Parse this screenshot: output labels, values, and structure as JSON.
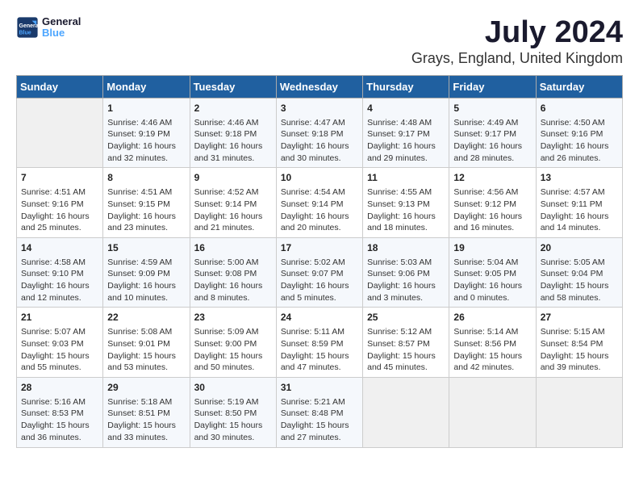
{
  "header": {
    "logo_line1": "General",
    "logo_line2": "Blue",
    "title": "July 2024",
    "subtitle": "Grays, England, United Kingdom"
  },
  "columns": [
    "Sunday",
    "Monday",
    "Tuesday",
    "Wednesday",
    "Thursday",
    "Friday",
    "Saturday"
  ],
  "weeks": [
    [
      {
        "day": "",
        "content": ""
      },
      {
        "day": "1",
        "content": "Sunrise: 4:46 AM\nSunset: 9:19 PM\nDaylight: 16 hours\nand 32 minutes."
      },
      {
        "day": "2",
        "content": "Sunrise: 4:46 AM\nSunset: 9:18 PM\nDaylight: 16 hours\nand 31 minutes."
      },
      {
        "day": "3",
        "content": "Sunrise: 4:47 AM\nSunset: 9:18 PM\nDaylight: 16 hours\nand 30 minutes."
      },
      {
        "day": "4",
        "content": "Sunrise: 4:48 AM\nSunset: 9:17 PM\nDaylight: 16 hours\nand 29 minutes."
      },
      {
        "day": "5",
        "content": "Sunrise: 4:49 AM\nSunset: 9:17 PM\nDaylight: 16 hours\nand 28 minutes."
      },
      {
        "day": "6",
        "content": "Sunrise: 4:50 AM\nSunset: 9:16 PM\nDaylight: 16 hours\nand 26 minutes."
      }
    ],
    [
      {
        "day": "7",
        "content": "Sunrise: 4:51 AM\nSunset: 9:16 PM\nDaylight: 16 hours\nand 25 minutes."
      },
      {
        "day": "8",
        "content": "Sunrise: 4:51 AM\nSunset: 9:15 PM\nDaylight: 16 hours\nand 23 minutes."
      },
      {
        "day": "9",
        "content": "Sunrise: 4:52 AM\nSunset: 9:14 PM\nDaylight: 16 hours\nand 21 minutes."
      },
      {
        "day": "10",
        "content": "Sunrise: 4:54 AM\nSunset: 9:14 PM\nDaylight: 16 hours\nand 20 minutes."
      },
      {
        "day": "11",
        "content": "Sunrise: 4:55 AM\nSunset: 9:13 PM\nDaylight: 16 hours\nand 18 minutes."
      },
      {
        "day": "12",
        "content": "Sunrise: 4:56 AM\nSunset: 9:12 PM\nDaylight: 16 hours\nand 16 minutes."
      },
      {
        "day": "13",
        "content": "Sunrise: 4:57 AM\nSunset: 9:11 PM\nDaylight: 16 hours\nand 14 minutes."
      }
    ],
    [
      {
        "day": "14",
        "content": "Sunrise: 4:58 AM\nSunset: 9:10 PM\nDaylight: 16 hours\nand 12 minutes."
      },
      {
        "day": "15",
        "content": "Sunrise: 4:59 AM\nSunset: 9:09 PM\nDaylight: 16 hours\nand 10 minutes."
      },
      {
        "day": "16",
        "content": "Sunrise: 5:00 AM\nSunset: 9:08 PM\nDaylight: 16 hours\nand 8 minutes."
      },
      {
        "day": "17",
        "content": "Sunrise: 5:02 AM\nSunset: 9:07 PM\nDaylight: 16 hours\nand 5 minutes."
      },
      {
        "day": "18",
        "content": "Sunrise: 5:03 AM\nSunset: 9:06 PM\nDaylight: 16 hours\nand 3 minutes."
      },
      {
        "day": "19",
        "content": "Sunrise: 5:04 AM\nSunset: 9:05 PM\nDaylight: 16 hours\nand 0 minutes."
      },
      {
        "day": "20",
        "content": "Sunrise: 5:05 AM\nSunset: 9:04 PM\nDaylight: 15 hours\nand 58 minutes."
      }
    ],
    [
      {
        "day": "21",
        "content": "Sunrise: 5:07 AM\nSunset: 9:03 PM\nDaylight: 15 hours\nand 55 minutes."
      },
      {
        "day": "22",
        "content": "Sunrise: 5:08 AM\nSunset: 9:01 PM\nDaylight: 15 hours\nand 53 minutes."
      },
      {
        "day": "23",
        "content": "Sunrise: 5:09 AM\nSunset: 9:00 PM\nDaylight: 15 hours\nand 50 minutes."
      },
      {
        "day": "24",
        "content": "Sunrise: 5:11 AM\nSunset: 8:59 PM\nDaylight: 15 hours\nand 47 minutes."
      },
      {
        "day": "25",
        "content": "Sunrise: 5:12 AM\nSunset: 8:57 PM\nDaylight: 15 hours\nand 45 minutes."
      },
      {
        "day": "26",
        "content": "Sunrise: 5:14 AM\nSunset: 8:56 PM\nDaylight: 15 hours\nand 42 minutes."
      },
      {
        "day": "27",
        "content": "Sunrise: 5:15 AM\nSunset: 8:54 PM\nDaylight: 15 hours\nand 39 minutes."
      }
    ],
    [
      {
        "day": "28",
        "content": "Sunrise: 5:16 AM\nSunset: 8:53 PM\nDaylight: 15 hours\nand 36 minutes."
      },
      {
        "day": "29",
        "content": "Sunrise: 5:18 AM\nSunset: 8:51 PM\nDaylight: 15 hours\nand 33 minutes."
      },
      {
        "day": "30",
        "content": "Sunrise: 5:19 AM\nSunset: 8:50 PM\nDaylight: 15 hours\nand 30 minutes."
      },
      {
        "day": "31",
        "content": "Sunrise: 5:21 AM\nSunset: 8:48 PM\nDaylight: 15 hours\nand 27 minutes."
      },
      {
        "day": "",
        "content": ""
      },
      {
        "day": "",
        "content": ""
      },
      {
        "day": "",
        "content": ""
      }
    ]
  ]
}
